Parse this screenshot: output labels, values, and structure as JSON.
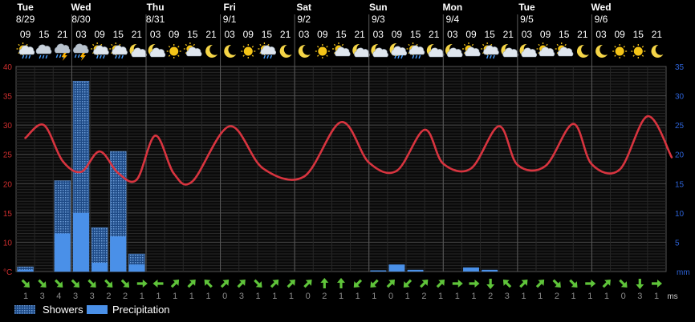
{
  "chart_data": {
    "type": "bar",
    "days": [
      {
        "name": "Tue",
        "date": "8/29",
        "start": 0
      },
      {
        "name": "Wed",
        "date": "8/30",
        "start": 3
      },
      {
        "name": "Thu",
        "date": "8/31",
        "start": 7
      },
      {
        "name": "Fri",
        "date": "9/1",
        "start": 11
      },
      {
        "name": "Sat",
        "date": "9/2",
        "start": 15
      },
      {
        "name": "Sun",
        "date": "9/3",
        "start": 19
      },
      {
        "name": "Mon",
        "date": "9/4",
        "start": 23
      },
      {
        "name": "Tue",
        "date": "9/5",
        "start": 27
      },
      {
        "name": "Wed",
        "date": "9/6",
        "start": 31
      }
    ],
    "hours": [
      "09",
      "15",
      "21",
      "03",
      "09",
      "15",
      "21",
      "03",
      "09",
      "15",
      "21",
      "03",
      "09",
      "15",
      "21",
      "03",
      "09",
      "15",
      "21",
      "03",
      "09",
      "15",
      "21",
      "03",
      "09",
      "15",
      "21",
      "03",
      "09",
      "15",
      "21",
      "03",
      "09",
      "15",
      "21"
    ],
    "icons": [
      "sun-rain",
      "cloud-rain",
      "storm",
      "storm",
      "sun-rain",
      "sun-rain",
      "moon-cloud",
      "moon-cloud",
      "sun",
      "sun-cloud",
      "moon",
      "moon",
      "sun",
      "sun-rain",
      "moon",
      "moon",
      "sun",
      "sun-cloud",
      "moon-cloud",
      "moon-cloud",
      "moon-rain",
      "sun-rain",
      "moon-cloud",
      "moon-cloud",
      "sun-cloud",
      "sun-rain",
      "moon-cloud",
      "moon-cloud",
      "sun-cloud",
      "sun-cloud",
      "moon",
      "moon",
      "sun",
      "sun",
      "moon"
    ],
    "temperature": [
      27.8,
      30.0,
      23.9,
      22.0,
      25.5,
      21.8,
      20.7,
      28.2,
      21.7,
      20.4,
      29.8,
      22.6,
      21.2,
      30.5,
      23.6,
      22.2,
      29.2,
      23.4,
      22.6,
      29.8,
      23.2,
      23.0,
      30.2,
      23.3,
      22.4,
      31.5,
      24.5
    ],
    "temperature_hours": [
      0,
      1,
      2,
      3,
      4,
      5,
      6,
      7,
      8,
      9,
      11,
      12.8,
      15,
      17,
      18.5,
      20,
      21.5,
      22.5,
      24,
      25.5,
      26.5,
      28,
      29.5,
      30.5,
      32,
      33.5,
      34.8
    ],
    "showers": [
      0.5,
      0,
      9.0,
      22.5,
      6.0,
      14.5,
      1.8,
      0,
      0,
      0,
      0,
      0,
      0,
      0,
      0,
      0,
      0,
      0,
      0,
      0,
      0,
      0,
      0,
      0,
      0,
      0,
      0,
      0,
      0,
      0,
      0,
      0,
      0,
      0,
      0
    ],
    "precipitation": [
      0.3,
      0,
      6.5,
      10.0,
      1.5,
      6.0,
      1.2,
      0,
      0,
      0,
      0,
      0,
      0,
      0,
      0,
      0,
      0,
      0,
      0,
      0.2,
      1.2,
      0.3,
      0,
      0,
      0.7,
      0.3,
      0,
      0,
      0,
      0,
      0,
      0,
      0,
      0,
      0
    ],
    "wind_speed": [
      1,
      3,
      4,
      3,
      3,
      2,
      2,
      1,
      1,
      1,
      1,
      1,
      0,
      3,
      1,
      1,
      1,
      0,
      2,
      1,
      1,
      1,
      0,
      1,
      2,
      1,
      1,
      1,
      2,
      3,
      1,
      1,
      2,
      1,
      1,
      1,
      0,
      3,
      1
    ],
    "wind_arrows": [
      "se",
      "se",
      "se",
      "se",
      "se",
      "se",
      "se",
      "e",
      "w",
      "ne",
      "ne",
      "nw",
      "ne",
      "ne",
      "se",
      "ne",
      "ne",
      "ne",
      "n",
      "n",
      "sw",
      "sw",
      "ne",
      "sw",
      "ne",
      "ne",
      "e",
      "e",
      "s",
      "nw",
      "ne",
      "ne",
      "se",
      "se",
      "e",
      "ne",
      "se",
      "s",
      "e"
    ],
    "y_left": {
      "unit": "°C",
      "min": 5,
      "max": 40,
      "ticks": [
        "",
        "10",
        "15",
        "20",
        "25",
        "30",
        "35",
        "40"
      ]
    },
    "y_right": {
      "unit": "mm",
      "min": 0,
      "max": 35,
      "ticks": [
        "",
        "5",
        "10",
        "15",
        "20",
        "25",
        "30",
        "35"
      ]
    },
    "wind_unit": "ms",
    "legend": {
      "showers": "Showers",
      "precipitation": "Precipitation"
    },
    "colors": {
      "temperature": "#d8343f",
      "precipitation": "#4a90e8",
      "showers": "#2c5c96",
      "grid": "#3c3c3c",
      "axis_left": "#cc2e2e",
      "axis_right": "#2d63d8",
      "wind_arrow": "#5fc43a",
      "background": "#000000"
    }
  }
}
